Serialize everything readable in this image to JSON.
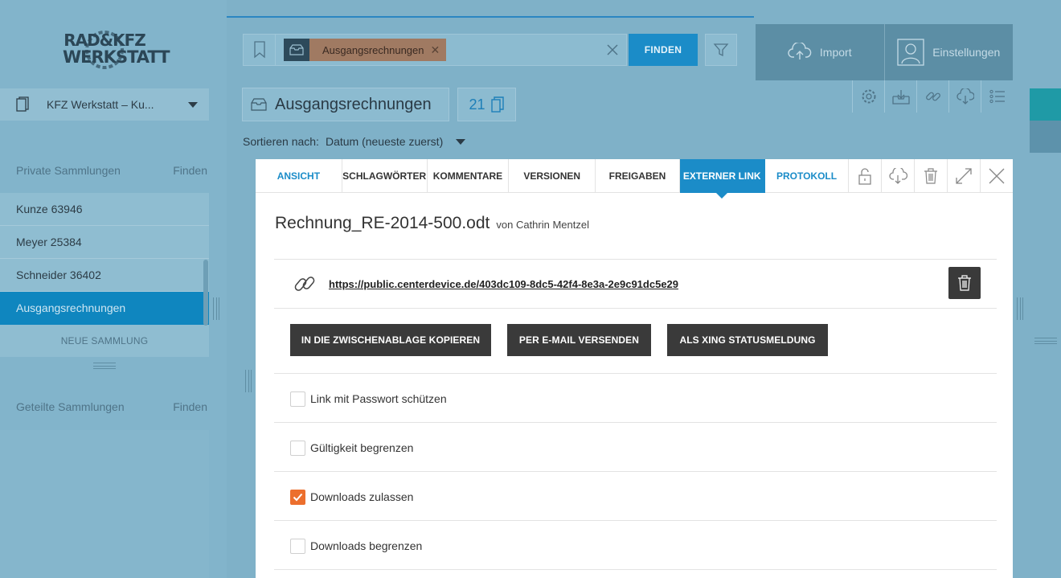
{
  "logo": {
    "line1": "RAD&KFZ",
    "line2": "WERKSTATT"
  },
  "sidebar": {
    "collection_select": "KFZ Werkstatt – Ku...",
    "private_title": "Private Sammlungen",
    "private_find": "Finden",
    "items": [
      {
        "label": "Kunze 63946"
      },
      {
        "label": "Meyer 25384"
      },
      {
        "label": "Schneider 36402"
      },
      {
        "label": "Ausgangsrechnungen"
      }
    ],
    "new_collection": "NEUE SAMMLUNG",
    "shared_title": "Geteilte Sammlungen",
    "shared_find": "Finden"
  },
  "search": {
    "tag_label": "Ausgangsrechnungen",
    "find_button": "FINDEN"
  },
  "top_actions": {
    "import": "Import",
    "settings": "Einstellungen"
  },
  "collection": {
    "title": "Ausgangsrechnungen",
    "count": "21",
    "sort_label": "Sortieren nach:",
    "sort_value": "Datum (neueste zuerst)"
  },
  "tabs": [
    "ANSICHT",
    "SCHLAGWÖRTER",
    "KOMMENTARE",
    "VERSIONEN",
    "FREIGABEN",
    "EXTERNER LINK",
    "PROTOKOLL"
  ],
  "document": {
    "name": "Rechnung_RE-2014-500.odt",
    "by": "von Cathrin Mentzel",
    "link": "https://public.centerdevice.de/403dc109-8dc5-42f4-8e3a-2e9c91dc5e29"
  },
  "buttons": {
    "copy": "IN DIE ZWISCHENABLAGE KOPIEREN",
    "email": "PER E-MAIL VERSENDEN",
    "xing": "ALS XING STATUSMELDUNG"
  },
  "options": [
    {
      "label": "Link mit Passwort schützen",
      "checked": false
    },
    {
      "label": "Gültigkeit begrenzen",
      "checked": false
    },
    {
      "label": "Downloads zulassen",
      "checked": true
    },
    {
      "label": "Downloads begrenzen",
      "checked": false
    }
  ],
  "colors": {
    "accent": "#1b8cc8",
    "checkbox_checked": "#ec6f2d",
    "dark_button": "#3a3a3a"
  }
}
